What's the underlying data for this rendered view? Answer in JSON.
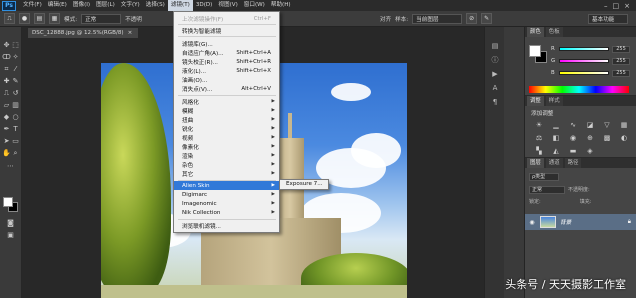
{
  "app": {
    "logo": "Ps"
  },
  "menubar": {
    "items": [
      "文件(F)",
      "编辑(E)",
      "图像(I)",
      "图层(L)",
      "文字(Y)",
      "选择(S)",
      "滤镜(T)",
      "3D(D)",
      "视图(V)",
      "窗口(W)",
      "帮助(H)"
    ],
    "active_index": 6
  },
  "options": {
    "mode_label": "模式:",
    "mode_value": "正常",
    "opacity_label": "不透明",
    "align_label": "对齐",
    "sample_label": "样本:",
    "sample_value": "当前图层",
    "workspace": "基本功能"
  },
  "document": {
    "tab_title": "DSC_12888.jpg @ 12.5%(RGB/8)",
    "close": "×"
  },
  "filter_menu": {
    "items": [
      {
        "label": "上次滤镜操作(F)",
        "shortcut": "Ctrl+F",
        "disabled": true
      },
      {
        "label": "转换为智能滤镜"
      },
      {
        "label": "滤镜库(G)..."
      },
      {
        "label": "自适应广角(A)...",
        "shortcut": "Shift+Ctrl+A"
      },
      {
        "label": "镜头校正(R)...",
        "shortcut": "Shift+Ctrl+R"
      },
      {
        "label": "液化(L)...",
        "shortcut": "Shift+Ctrl+X"
      },
      {
        "label": "油画(O)..."
      },
      {
        "label": "消失点(V)...",
        "shortcut": "Alt+Ctrl+V"
      },
      {
        "label": "风格化",
        "submenu": true
      },
      {
        "label": "模糊",
        "submenu": true
      },
      {
        "label": "扭曲",
        "submenu": true
      },
      {
        "label": "锐化",
        "submenu": true
      },
      {
        "label": "视频",
        "submenu": true
      },
      {
        "label": "像素化",
        "submenu": true
      },
      {
        "label": "渲染",
        "submenu": true
      },
      {
        "label": "杂色",
        "submenu": true
      },
      {
        "label": "其它",
        "submenu": true
      },
      {
        "label": "Alien Skin",
        "submenu": true,
        "highlighted": true
      },
      {
        "label": "Digimarc",
        "submenu": true
      },
      {
        "label": "Imagenomic",
        "submenu": true
      },
      {
        "label": "Nik Collection",
        "submenu": true
      },
      {
        "label": "浏览联机滤镜..."
      }
    ],
    "submenu_item": "Exposure 7..."
  },
  "panels": {
    "color_tabs": [
      "颜色",
      "色板"
    ],
    "rgb": [
      {
        "channel": "R",
        "value": "255"
      },
      {
        "channel": "G",
        "value": "255"
      },
      {
        "channel": "B",
        "value": "255"
      }
    ],
    "adj_tabs": [
      "调整",
      "样式"
    ],
    "adj_title": "添加调整",
    "layers_tabs": [
      "图层",
      "通道",
      "路径"
    ],
    "kind_label": "ρ类型",
    "blend_mode": "正常",
    "opacity_label": "不透明度:",
    "lock_label": "锁定:",
    "fill_label": "填充:",
    "layer_name": "背景"
  },
  "watermark": "头条号 / 天天摄影工作室",
  "colors": {
    "highlight": "#3179d8",
    "panel": "#454545",
    "bg": "#282828"
  }
}
